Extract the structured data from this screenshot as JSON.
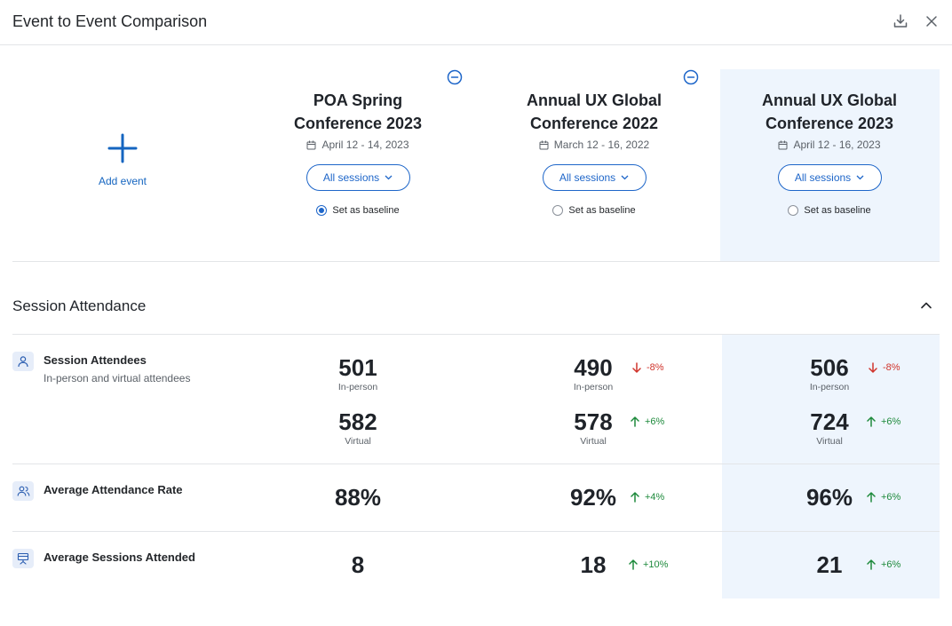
{
  "header": {
    "title": "Event to Event Comparison",
    "download_icon": "download-icon",
    "close_icon": "close-icon"
  },
  "add_event": {
    "label": "Add event",
    "icon": "plus-icon"
  },
  "events": [
    {
      "name_line1": "POA Spring",
      "name_line2": "Conference 2023",
      "date": "April 12 - 14, 2023",
      "sessions_label": "All sessions",
      "baseline_label": "Set as baseline",
      "is_baseline": true,
      "removable": true,
      "highlighted": false
    },
    {
      "name_line1": "Annual UX Global",
      "name_line2": "Conference 2022",
      "date": "March 12 - 16, 2022",
      "sessions_label": "All sessions",
      "baseline_label": "Set as baseline",
      "is_baseline": false,
      "removable": true,
      "highlighted": false
    },
    {
      "name_line1": "Annual UX Global",
      "name_line2": "Conference 2023",
      "date": "April 12 - 16, 2023",
      "sessions_label": "All sessions",
      "baseline_label": "Set as baseline",
      "is_baseline": false,
      "removable": false,
      "highlighted": true
    }
  ],
  "section": {
    "title": "Session Attendance",
    "collapse_icon": "chevron-up-icon"
  },
  "metrics": {
    "attendees": {
      "label": "Session Attendees",
      "sub": "In-person and virtual attendees",
      "icon": "person-icon",
      "inperson_label": "In-person",
      "virtual_label": "Virtual",
      "values": [
        {
          "inperson": "501",
          "virtual": "582"
        },
        {
          "inperson": "490",
          "inperson_delta": "-8%",
          "inperson_dir": "down",
          "virtual": "578",
          "virtual_delta": "+6%",
          "virtual_dir": "up"
        },
        {
          "inperson": "506",
          "inperson_delta": "-8%",
          "inperson_dir": "down",
          "virtual": "724",
          "virtual_delta": "+6%",
          "virtual_dir": "up"
        }
      ]
    },
    "rate": {
      "label": "Average Attendance Rate",
      "icon": "people-icon",
      "values": [
        {
          "value": "88%"
        },
        {
          "value": "92%",
          "delta": "+4%",
          "dir": "up"
        },
        {
          "value": "96%",
          "delta": "+6%",
          "dir": "up"
        }
      ]
    },
    "sessions": {
      "label": "Average Sessions Attended",
      "icon": "presentation-icon",
      "values": [
        {
          "value": "8"
        },
        {
          "value": "18",
          "delta": "+10%",
          "dir": "up"
        },
        {
          "value": "21",
          "delta": "+6%",
          "dir": "up"
        }
      ]
    }
  },
  "colors": {
    "accent": "#1e66c9",
    "highlight": "#eef5fd",
    "down": "#d0342c",
    "up": "#1e8a3c"
  }
}
